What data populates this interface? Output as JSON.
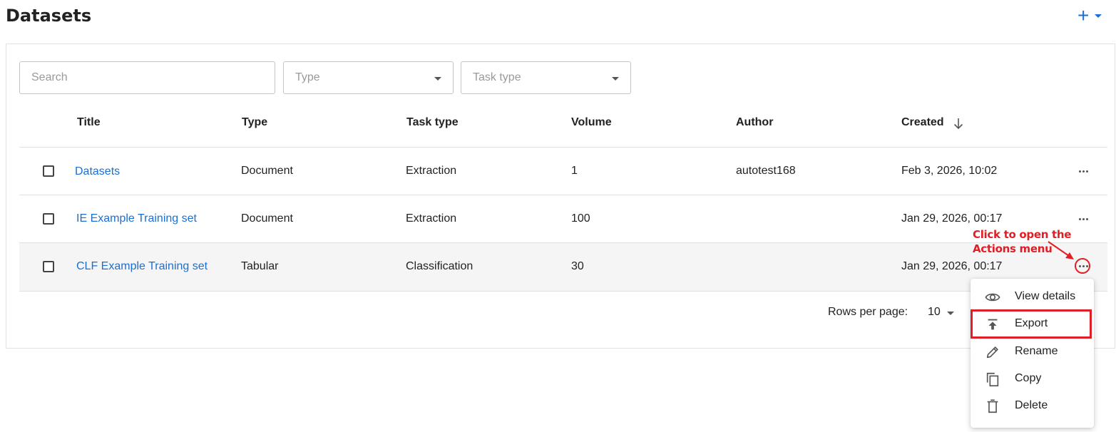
{
  "header": {
    "title": "Datasets",
    "add_symbol": "+"
  },
  "filters": {
    "search_placeholder": "Search",
    "type_placeholder": "Type",
    "task_type_placeholder": "Task type"
  },
  "table": {
    "columns": [
      "Title",
      "Type",
      "Task type",
      "Volume",
      "Author",
      "Created"
    ],
    "sort_column": "Created",
    "sort_direction": "descending",
    "rows": [
      {
        "title": "Datasets",
        "type": "Document",
        "task_type": "Extraction",
        "volume": "1",
        "author": "autotest168",
        "created": "Feb 3, 2026, 10:02"
      },
      {
        "title": "IE Example Training set",
        "type": "Document",
        "task_type": "Extraction",
        "volume": "100",
        "author": "",
        "created": "Jan 29, 2026, 00:17"
      },
      {
        "title": "CLF Example Training set",
        "type": "Tabular",
        "task_type": "Classification",
        "volume": "30",
        "author": "",
        "created": "Jan 29, 2026, 00:17"
      }
    ]
  },
  "pagination": {
    "rows_per_page_label": "Rows per page:",
    "rows_per_page_value": "10"
  },
  "annotation": {
    "line1": "Click to open the",
    "line2": "Actions menu",
    "color": "#e01e25"
  },
  "actions_menu": {
    "items": [
      {
        "label": "View details",
        "icon": "eye-icon"
      },
      {
        "label": "Export",
        "icon": "export-icon",
        "highlighted": true
      },
      {
        "label": "Rename",
        "icon": "pencil-icon"
      },
      {
        "label": "Copy",
        "icon": "copy-icon"
      },
      {
        "label": "Delete",
        "icon": "trash-icon"
      }
    ]
  },
  "colors": {
    "link": "#1a6fd4",
    "accent": "#1a6fd4",
    "annotation": "#e01e25",
    "hover_row": "#f5f5f5"
  }
}
